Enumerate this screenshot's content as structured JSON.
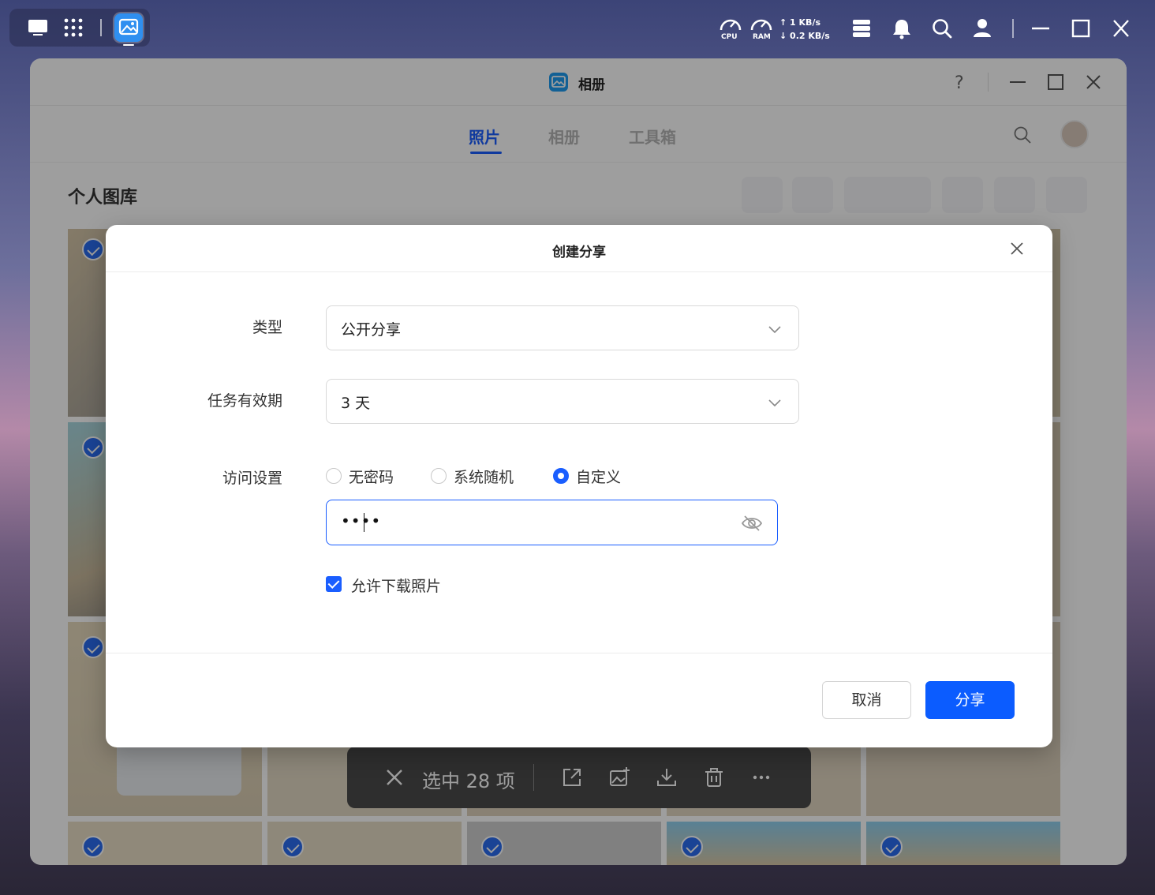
{
  "system_bar": {
    "cpu_label": "CPU",
    "ram_label": "RAM",
    "net_up": "1 KB/s",
    "net_down": "0.2 KB/s",
    "icons": [
      "desktop-icon",
      "apps-grid-icon",
      "photos-app-icon",
      "cpu-gauge-icon",
      "ram-gauge-icon",
      "storage-icon",
      "bell-icon",
      "search-icon",
      "user-icon",
      "minimize-icon",
      "maximize-icon",
      "close-icon"
    ]
  },
  "window": {
    "title": "相册",
    "tabs": [
      {
        "label": "照片",
        "active": true
      },
      {
        "label": "相册",
        "active": false
      },
      {
        "label": "工具箱",
        "active": false
      }
    ],
    "library_title": "个人图库"
  },
  "selection_bar": {
    "text": "选中 28 项",
    "icons": [
      "close-icon",
      "share-icon",
      "add-to-album-icon",
      "download-icon",
      "delete-icon",
      "more-icon"
    ]
  },
  "dialog": {
    "title": "创建分享",
    "type_label": "类型",
    "type_value": "公开分享",
    "validity_label": "任务有效期",
    "validity_value": "3 天",
    "access_label": "访问设置",
    "access_options": [
      {
        "label": "无密码",
        "selected": false
      },
      {
        "label": "系统随机",
        "selected": false
      },
      {
        "label": "自定义",
        "selected": true
      }
    ],
    "password_value": "••••",
    "allow_download_label": "允许下载照片",
    "allow_download_checked": true,
    "cancel_label": "取消",
    "share_label": "分享"
  },
  "colors": {
    "accent": "#1a5eff",
    "primary_button": "#0b5cff"
  }
}
